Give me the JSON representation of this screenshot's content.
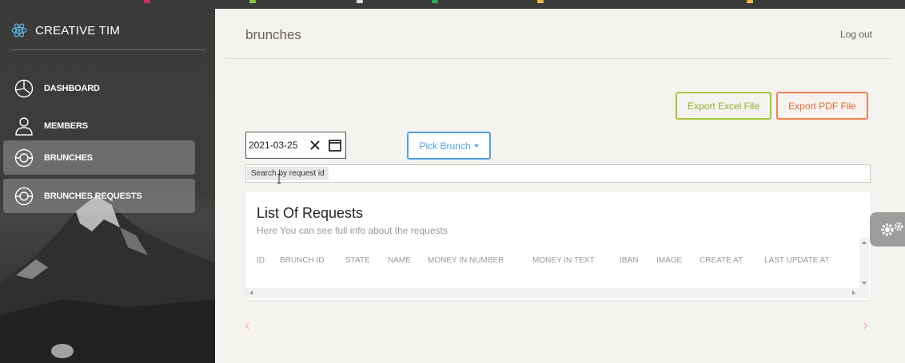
{
  "brand": {
    "name": "CREATIVE TIM"
  },
  "sidebar": {
    "items": [
      {
        "label": "DASHBOARD",
        "icon": "chart-pie-icon",
        "active": false
      },
      {
        "label": "MEMBERS",
        "icon": "user-icon",
        "active": false
      },
      {
        "label": "BRUNCHES",
        "icon": "compass-icon",
        "active": true
      },
      {
        "label": "BRUNCHES REQUESTS",
        "icon": "compass-icon",
        "active": true
      }
    ]
  },
  "navbar": {
    "title": "brunches",
    "logout": "Log out"
  },
  "actions": {
    "export_excel": "Export Excel File",
    "export_pdf": "Export PDF File"
  },
  "filters": {
    "date_value": "2021-03-25",
    "pick_label": "Pick Brunch",
    "search_placeholder": "Search by request id"
  },
  "card": {
    "title": "List Of Requests",
    "subtitle": "Here You can see full info about the requests",
    "columns": [
      "ID",
      "BRUNCH ID",
      "STATE",
      "NAME",
      "MONEY IN NUMBER",
      "MONEY IN TEXT",
      "IBAN",
      "IMAGE",
      "CREATE AT",
      "LAST UPDATE AT"
    ],
    "rows": []
  },
  "pagination": {
    "prev": "‹",
    "next": "›"
  },
  "colors": {
    "success": "#a4c639",
    "danger": "#ef8157",
    "info": "#51a0e0",
    "sidebar": "#3c3b39"
  }
}
